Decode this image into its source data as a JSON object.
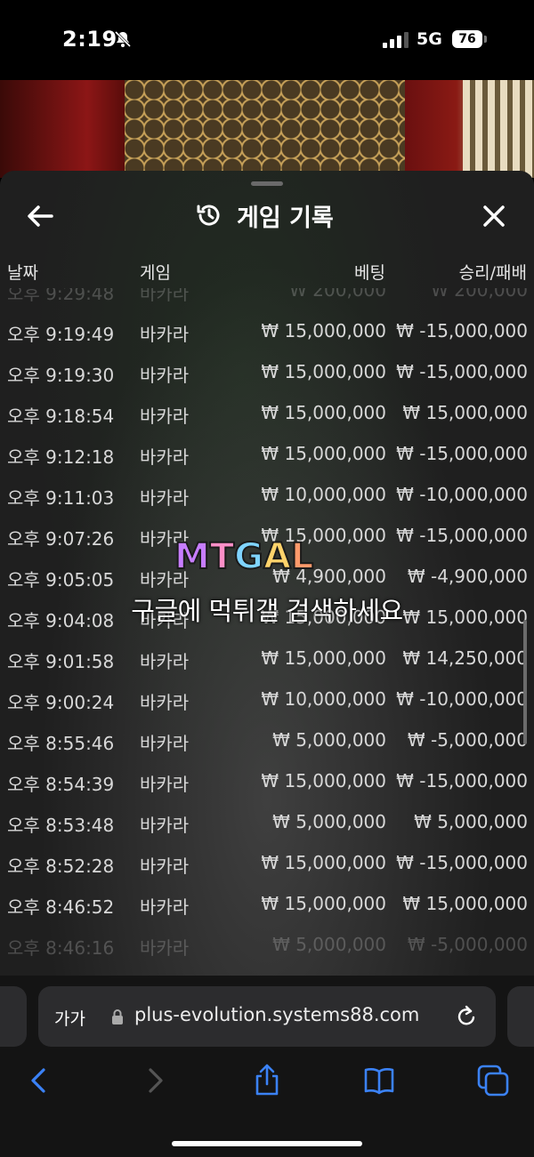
{
  "status_bar": {
    "time": "2:19",
    "network": "5G",
    "battery": "76"
  },
  "sheet": {
    "title": "게임 기록"
  },
  "columns": {
    "date": "날짜",
    "game": "게임",
    "bet": "베팅",
    "result": "승리/패배"
  },
  "rows": [
    {
      "date": "오후 9:29:48",
      "game": "바카라",
      "bet": "₩ 200,000",
      "result": "₩ 200,000",
      "partial": true
    },
    {
      "date": "오후 9:19:49",
      "game": "바카라",
      "bet": "₩ 15,000,000",
      "result": "₩ -15,000,000"
    },
    {
      "date": "오후 9:19:30",
      "game": "바카라",
      "bet": "₩ 15,000,000",
      "result": "₩ -15,000,000"
    },
    {
      "date": "오후 9:18:54",
      "game": "바카라",
      "bet": "₩ 15,000,000",
      "result": "₩ 15,000,000"
    },
    {
      "date": "오후 9:12:18",
      "game": "바카라",
      "bet": "₩ 15,000,000",
      "result": "₩ -15,000,000"
    },
    {
      "date": "오후 9:11:03",
      "game": "바카라",
      "bet": "₩ 10,000,000",
      "result": "₩ -10,000,000"
    },
    {
      "date": "오후 9:07:26",
      "game": "바카라",
      "bet": "₩ 15,000,000",
      "result": "₩ -15,000,000"
    },
    {
      "date": "오후 9:05:05",
      "game": "바카라",
      "bet": "₩ 4,900,000",
      "result": "₩ -4,900,000"
    },
    {
      "date": "오후 9:04:08",
      "game": "바카라",
      "bet": "₩ 15,000,000",
      "result": "₩ 15,000,000"
    },
    {
      "date": "오후 9:01:58",
      "game": "바카라",
      "bet": "₩ 15,000,000",
      "result": "₩ 14,250,000"
    },
    {
      "date": "오후 9:00:24",
      "game": "바카라",
      "bet": "₩ 10,000,000",
      "result": "₩ -10,000,000"
    },
    {
      "date": "오후 8:55:46",
      "game": "바카라",
      "bet": "₩ 5,000,000",
      "result": "₩ -5,000,000"
    },
    {
      "date": "오후 8:54:39",
      "game": "바카라",
      "bet": "₩ 15,000,000",
      "result": "₩ -15,000,000"
    },
    {
      "date": "오후 8:53:48",
      "game": "바카라",
      "bet": "₩ 5,000,000",
      "result": "₩ 5,000,000"
    },
    {
      "date": "오후 8:52:28",
      "game": "바카라",
      "bet": "₩ 15,000,000",
      "result": "₩ -15,000,000"
    },
    {
      "date": "오후 8:46:52",
      "game": "바카라",
      "bet": "₩ 15,000,000",
      "result": "₩ 15,000,000"
    },
    {
      "date": "오후 8:46:16",
      "game": "바카라",
      "bet": "₩ 5,000,000",
      "result": "₩ -5,000,000",
      "partial": true
    }
  ],
  "watermark": {
    "logo_letters": [
      "M",
      "T",
      "G",
      "A",
      "L"
    ],
    "logo_colors": [
      "#c77dff",
      "#ff8fc7",
      "#7fd4ff",
      "#ffd36b",
      "#ff9a6b"
    ],
    "text": "구글에 먹튀갤 검색하세요"
  },
  "browser": {
    "text_size_label": "가가",
    "url": "plus-evolution.systems88.com"
  },
  "icons": {
    "status": [
      "bell-slash-icon",
      "signal-icon",
      "battery-icon"
    ],
    "sheet": [
      "back-arrow-icon",
      "history-icon",
      "close-icon"
    ],
    "browser": [
      "lock-icon",
      "reload-icon",
      "chevron-left-icon",
      "chevron-right-icon",
      "share-icon",
      "bookmarks-icon",
      "tabs-icon"
    ]
  },
  "colors": {
    "accent": "#3b82f6",
    "sheet_bg": "#1f1f1f"
  }
}
